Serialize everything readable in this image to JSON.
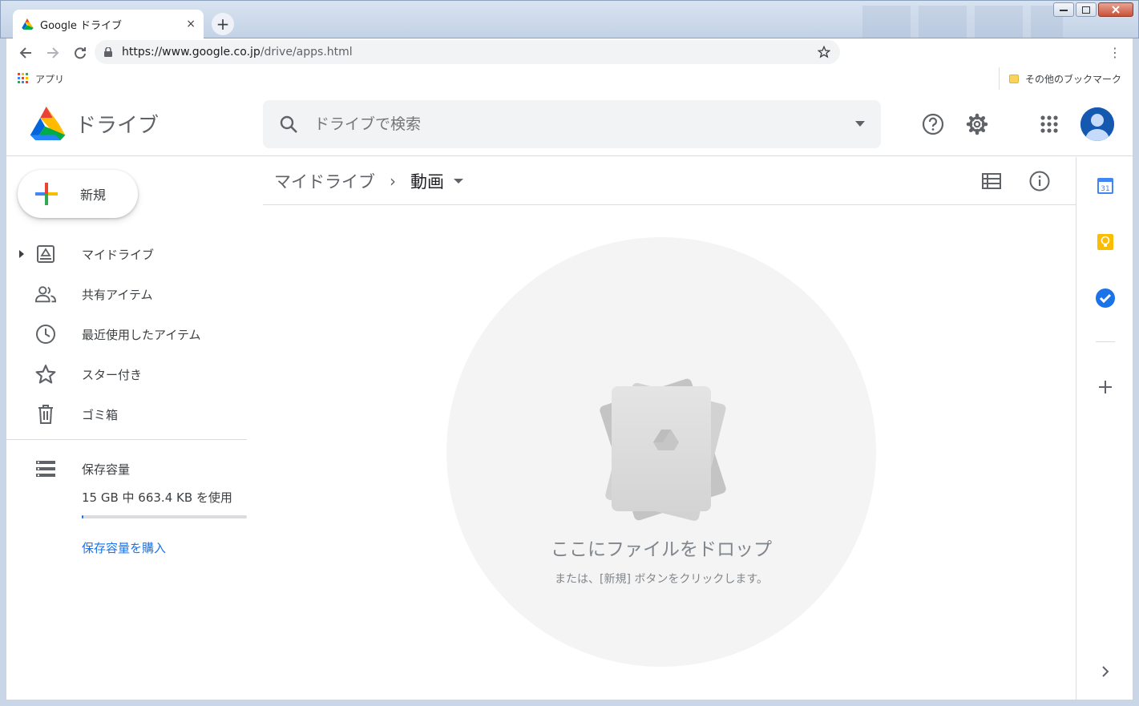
{
  "browser": {
    "tab_title": "Google ドライブ",
    "tab_close": "×",
    "new_tab": "+",
    "url_host": "https://www.google.co.jp",
    "url_path": "/drive/apps.html",
    "menu": "⋮",
    "bookmarks": {
      "apps_label": "アプリ",
      "other_label": "その他のブックマーク"
    }
  },
  "drive": {
    "logo_text": "ドライブ",
    "search_placeholder": "ドライブで検索",
    "new_button_label": "新規",
    "nav": [
      {
        "label": "マイドライブ",
        "icon": "my-drive-icon"
      },
      {
        "label": "共有アイテム",
        "icon": "shared-icon"
      },
      {
        "label": "最近使用したアイテム",
        "icon": "clock-icon"
      },
      {
        "label": "スター付き",
        "icon": "star-icon"
      },
      {
        "label": "ゴミ箱",
        "icon": "trash-icon"
      }
    ],
    "storage": {
      "label": "保存容量",
      "usage_text": "15 GB 中 663.4 KB を使用",
      "used_fraction": 0.0001,
      "buy_label": "保存容量を購入"
    },
    "breadcrumb": {
      "root": "マイドライブ",
      "separator": "›",
      "current": "動画"
    },
    "empty_state": {
      "title": "ここにファイルをドロップ",
      "subtitle": "または、[新規] ボタンをクリックします。"
    },
    "side_panel": {
      "calendar_day": "31"
    }
  },
  "colors": {
    "accent": "#1a73e8",
    "text": "#3c4043",
    "muted": "#5f6368"
  }
}
